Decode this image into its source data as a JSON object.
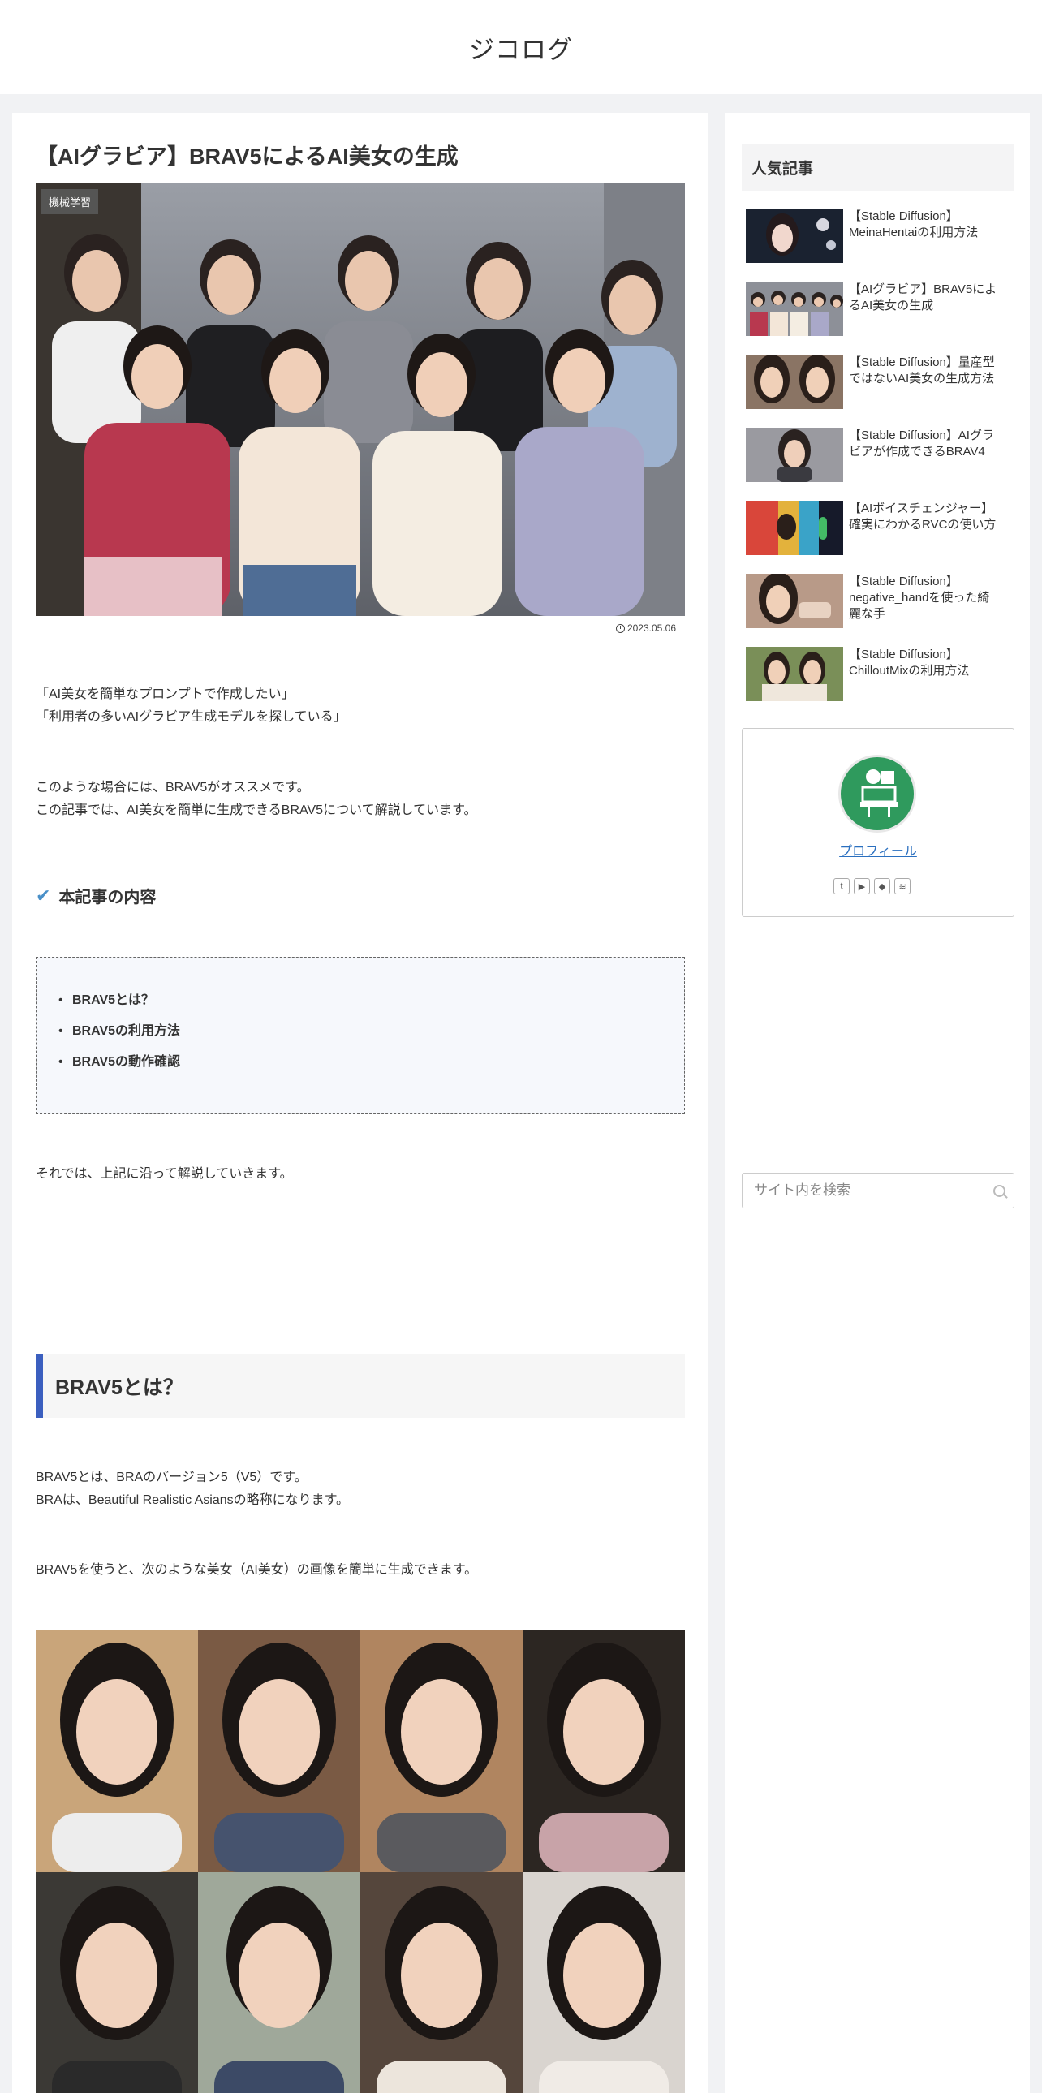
{
  "site": {
    "title": "ジコログ"
  },
  "article": {
    "title": "【AIグラビア】BRAV5によるAI美女の生成",
    "category": "機械学習",
    "date": "2023.05.06",
    "intro_line1": "「AI美女を簡単なプロンプトで作成したい」",
    "intro_line2": "「利用者の多いAIグラビア生成モデルを探している」",
    "rec_line1": "このような場合には、BRAV5がオススメです。",
    "rec_line2": "この記事では、AI美女を簡単に生成できるBRAV5について解説しています。",
    "toc_heading": "本記事の内容",
    "toc_items": [
      "BRAV5とは？",
      "BRAV5の利用方法",
      "BRAV5の動作確認"
    ],
    "transition": "それでは、上記に沿って解説していきます。",
    "h2": "BRAV5とは？",
    "def_line1": "BRAV5とは、BRAのバージョン5（V5）です。",
    "def_line2": "BRAは、Beautiful Realistic Asiansの略称になります。",
    "usage": "BRAV5を使うと、次のような美女（AI美女）の画像を簡単に生成できます。"
  },
  "sidebar": {
    "popular_title": "人気記事",
    "popular": [
      {
        "title": "【Stable Diffusion】MeinaHentaiの利用方法",
        "line1": "【Stable Diffusion】",
        "line2": "MeinaHentaiの利用方法",
        "line3": ""
      },
      {
        "title": "【AIグラビア】BRAV5によるAI美女の生成",
        "line1": "【AIグラビア】BRAV5によ",
        "line2": "るAI美女の生成",
        "line3": ""
      },
      {
        "title": "【Stable Diffusion】量産型ではないAI美女の生成方法",
        "line1": "【Stable Diffusion】量産型",
        "line2": "ではないAI美女の生成方法",
        "line3": ""
      },
      {
        "title": "【Stable Diffusion】AIグラビアが作成できるBRAV4",
        "line1": "【Stable Diffusion】AIグラ",
        "line2": "ビアが作成できるBRAV4",
        "line3": ""
      },
      {
        "title": "【AIボイスチェンジャー】確実にわかるRVCの使い方",
        "line1": "【AIボイスチェンジャー】",
        "line2": "確実にわかるRVCの使い方",
        "line3": ""
      },
      {
        "title": "【Stable Diffusion】negative_handを使った綺麗な手",
        "line1": "【Stable Diffusion】",
        "line2": "negative_handを使った綺",
        "line3": "麗な手"
      },
      {
        "title": "【Stable Diffusion】ChilloutMixの利用方法",
        "line1": "【Stable Diffusion】",
        "line2": "ChilloutMixの利用方法",
        "line3": ""
      }
    ],
    "profile_link": "プロフィール",
    "social_icons": [
      "twitter-icon",
      "youtube-icon",
      "feedly-icon",
      "rss-icon"
    ],
    "search_placeholder": "サイト内を検索"
  }
}
